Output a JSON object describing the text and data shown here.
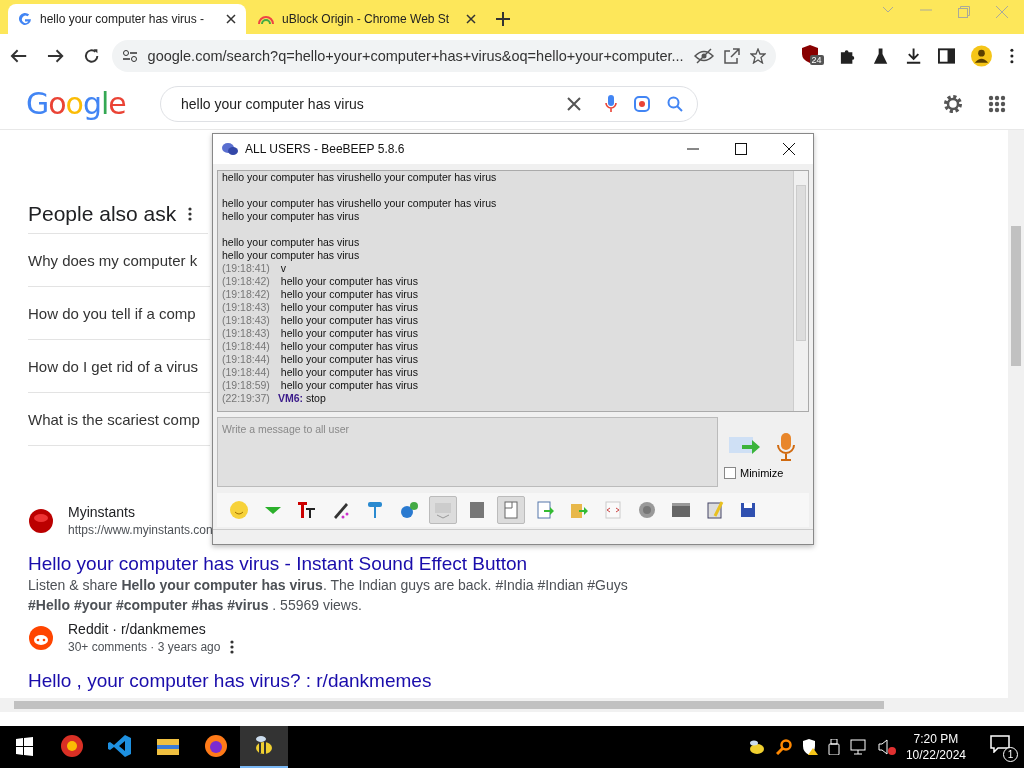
{
  "browser": {
    "tabs": [
      {
        "title": "hello your computer has virus -",
        "selected": true
      },
      {
        "title": "uBlock Origin - Chrome Web St",
        "selected": false
      }
    ],
    "address": "google.com/search?q=hello+your+computer+has+virus&oq=hello+your+computer...",
    "extension_badge": "24"
  },
  "google": {
    "logo": "Google",
    "query": "hello your computer has virus"
  },
  "people_also_ask": {
    "title": "People also ask",
    "questions": [
      "Why does my computer k",
      "How do you tell if a comp",
      "How do I get rid of a virus",
      "What is the scariest comp"
    ]
  },
  "results": [
    {
      "site": "Myinstants",
      "url": "https://www.myinstants.con",
      "title": "Hello your computer has virus - Instant Sound Effect Button",
      "snippet": "Listen & share **Hello your computer has virus**. The Indian guys are back. #India #Indian #Guys **#Hello #your #computer #has #virus** . 55969 views."
    },
    {
      "site": "Reddit · r/dankmemes",
      "meta": "30+ comments · 3 years ago",
      "title": "Hello , your computer has virus? : r/dankmemes"
    }
  ],
  "chat_window": {
    "title": "ALL USERS - BeeBEEP 5.8.6",
    "lines": [
      {
        "kind": "plain",
        "text": "hello your computer has virushello your computer has virus"
      },
      {
        "kind": "blank"
      },
      {
        "kind": "plain",
        "text": "hello your computer has virushello your computer has virus"
      },
      {
        "kind": "plain",
        "text": "hello your computer has virus"
      },
      {
        "kind": "blank"
      },
      {
        "kind": "plain",
        "text": "hello your computer has virus"
      },
      {
        "kind": "plain",
        "text": "hello your computer has virus"
      },
      {
        "kind": "timed",
        "time": "(19:18:41)",
        "text": "v"
      },
      {
        "kind": "timed",
        "time": "(19:18:42)",
        "text": "hello your computer has virus"
      },
      {
        "kind": "timed",
        "time": "(19:18:42)",
        "text": "hello your computer has virus"
      },
      {
        "kind": "timed",
        "time": "(19:18:43)",
        "text": "hello your computer has virus"
      },
      {
        "kind": "timed",
        "time": "(19:18:43)",
        "text": "hello your computer has virus"
      },
      {
        "kind": "timed",
        "time": "(19:18:43)",
        "text": "hello your computer has virus"
      },
      {
        "kind": "timed",
        "time": "(19:18:44)",
        "text": "hello your computer has virus"
      },
      {
        "kind": "timed",
        "time": "(19:18:44)",
        "text": "hello your computer has virus"
      },
      {
        "kind": "timed",
        "time": "(19:18:44)",
        "text": "hello your computer has virus"
      },
      {
        "kind": "timed",
        "time": "(19:18:59)",
        "text": "hello your computer has virus"
      },
      {
        "kind": "timed",
        "time": "(22:19:37)",
        "sender": "VM6:",
        "text": "stop"
      }
    ],
    "placeholder": "Write a message to all user",
    "minimize": {
      "label": "Minimize",
      "checked": false
    },
    "toolbar": [
      {
        "pressed": false
      },
      {
        "pressed": false
      },
      {
        "pressed": false
      },
      {
        "pressed": false
      },
      {
        "pressed": false
      },
      {
        "pressed": false
      },
      {
        "pressed": true
      },
      {
        "pressed": false
      },
      {
        "pressed": true
      },
      {
        "pressed": false
      },
      {
        "pressed": false
      },
      {
        "pressed": false
      },
      {
        "pressed": false
      },
      {
        "pressed": false
      },
      {
        "pressed": false
      },
      {
        "pressed": false
      }
    ]
  },
  "taskbar": {
    "apps": [
      {
        "selected": false
      },
      {
        "selected": false
      },
      {
        "selected": false
      },
      {
        "selected": false
      },
      {
        "selected": true
      }
    ],
    "time": "7:20 PM",
    "date": "10/22/2024",
    "notification_count": "1"
  }
}
